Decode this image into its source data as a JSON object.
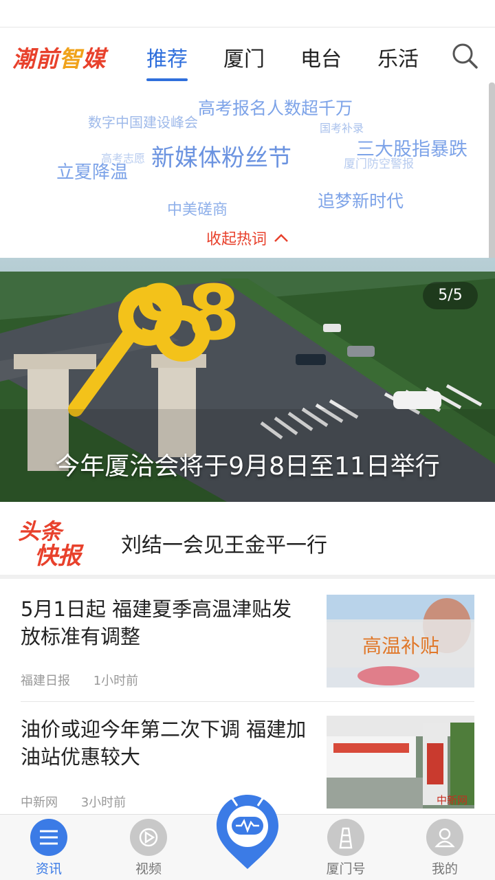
{
  "header": {
    "logo_part1": "潮前",
    "logo_part2": "智",
    "logo_part3": "媒",
    "tabs": [
      {
        "label": "推荐",
        "active": true
      },
      {
        "label": "厦门",
        "active": false
      },
      {
        "label": "电台",
        "active": false
      },
      {
        "label": "乐活",
        "active": false
      }
    ],
    "search_icon": "search-icon",
    "accent_color": "#2f6fdc"
  },
  "hotwords": {
    "items": [
      "高考报名人数超千万",
      "数字中国建设峰会",
      "国考补录",
      "高考志愿",
      "新媒体粉丝节",
      "三大股指暴跌",
      "立夏降温",
      "厦门防空警报",
      "中美磋商",
      "追梦新时代"
    ],
    "collapse_label": "收起热词"
  },
  "banner": {
    "counter": "5/5",
    "caption": "今年厦洽会将于9月8日至11日举行",
    "sculpture_text": "98"
  },
  "flash": {
    "logo_line1": "头条",
    "logo_line2": "快报",
    "headline": "刘结一会见王金平一行"
  },
  "news": [
    {
      "title": "5月1日起  福建夏季高温津贴发放标准有调整",
      "source": "福建日报",
      "time": "1小时前",
      "thumb_text": "高温补贴"
    },
    {
      "title": "油价或迎今年第二次下调  福建加油站优惠较大",
      "source": "中新网",
      "time": "3小时前",
      "thumb_text": "中新网"
    }
  ],
  "bottom_nav": [
    {
      "label": "资讯",
      "icon": "news-icon",
      "active": true
    },
    {
      "label": "视频",
      "icon": "play-icon",
      "active": false
    },
    {
      "label": "",
      "icon": "robot-icon",
      "active": false
    },
    {
      "label": "厦门号",
      "icon": "lighthouse-icon",
      "active": false
    },
    {
      "label": "我的",
      "icon": "user-icon",
      "active": false
    }
  ]
}
